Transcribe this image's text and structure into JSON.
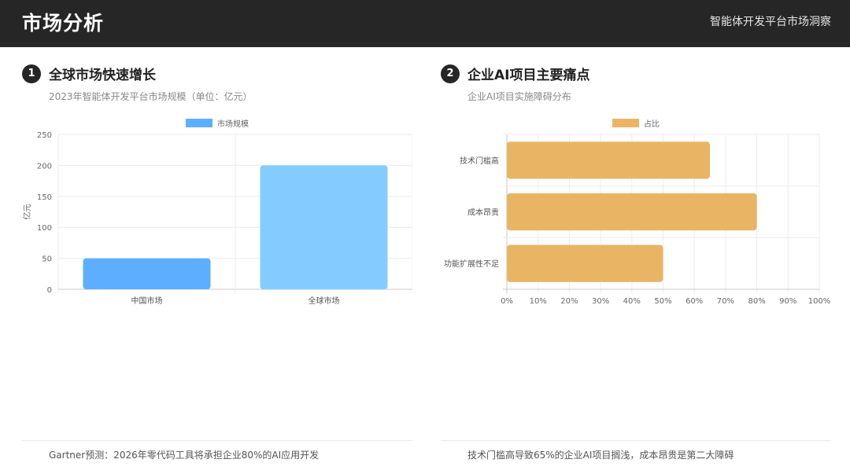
{
  "header": {
    "title": "市场分析",
    "subtitle": "智能体开发平台市场洞察"
  },
  "sections": [
    {
      "number": "1",
      "title": "全球市场快速增长",
      "subtitle": "2023年智能体开发平台市场规模（单位：亿元）",
      "note": "Gartner预测：2026年零代码工具将承担企业80%的AI应用开发"
    },
    {
      "number": "2",
      "title": "企业AI项目主要痛点",
      "subtitle": "企业AI项目实施障碍分布",
      "note": "技术门槛高导致65%的企业AI项目搁浅，成本昂贵是第二大障碍"
    }
  ],
  "chart_data": [
    {
      "type": "bar",
      "orientation": "vertical",
      "categories": [
        "中国市场",
        "全球市场"
      ],
      "series": [
        {
          "name": "市场规模",
          "values": [
            50,
            200
          ]
        }
      ],
      "bar_colors": [
        "#5eaeff",
        "#84ccff"
      ],
      "legend_color": "#5eaeff",
      "ylabel": "亿元",
      "ylim": [
        0,
        250
      ],
      "yticks": [
        0,
        50,
        100,
        150,
        200,
        250
      ],
      "grid": true,
      "legend": "top-center"
    },
    {
      "type": "bar",
      "orientation": "horizontal",
      "categories": [
        "技术门槛高",
        "成本昂贵",
        "功能扩展性不足"
      ],
      "series": [
        {
          "name": "占比",
          "values": [
            65,
            80,
            50
          ]
        }
      ],
      "bar_colors": [
        "#e9b564",
        "#e9b564",
        "#e9b564"
      ],
      "legend_color": "#e9b564",
      "xlim": [
        0,
        100
      ],
      "xticks": [
        "0%",
        "10%",
        "20%",
        "30%",
        "40%",
        "50%",
        "60%",
        "70%",
        "80%",
        "90%",
        "100%"
      ],
      "grid": true,
      "legend": "top-center"
    }
  ]
}
